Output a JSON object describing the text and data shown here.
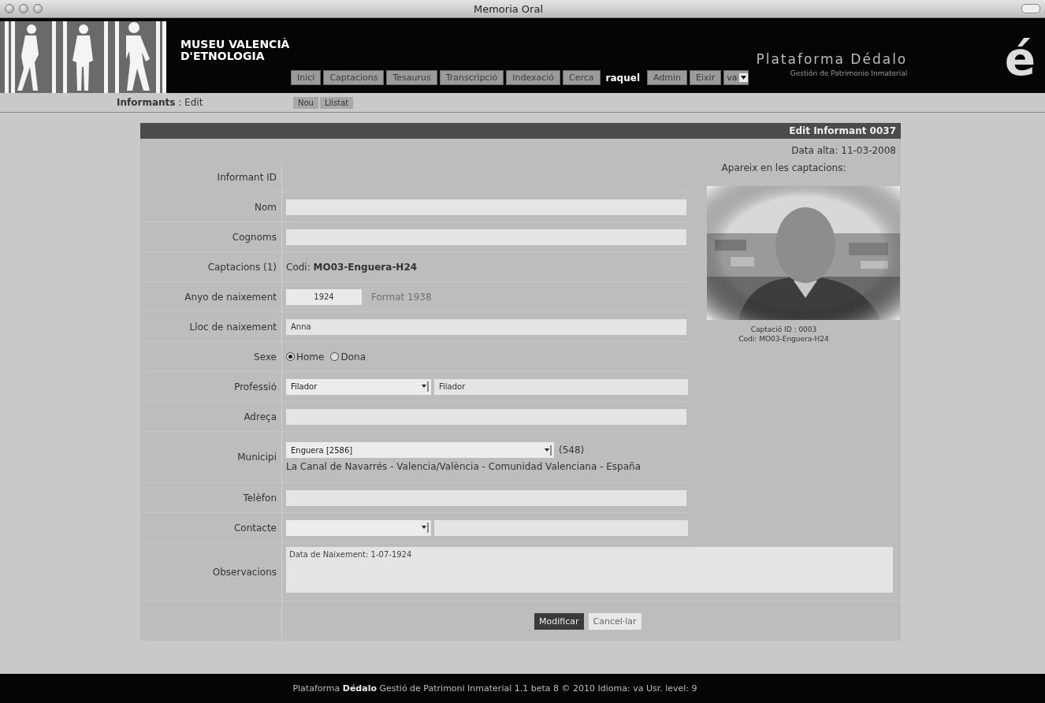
{
  "window": {
    "title": "Memoria Oral"
  },
  "header": {
    "logo_lines": [
      "MUSEU VALENCIÀ",
      "D'ETNOLOGIA"
    ],
    "nav": [
      {
        "label": "Inici",
        "selected": false
      },
      {
        "label": "Captacions",
        "selected": false
      },
      {
        "label": "Tesaurus",
        "selected": false
      },
      {
        "label": "Transcripció",
        "selected": false
      },
      {
        "label": "Indexació",
        "selected": false
      },
      {
        "label": "Cerca",
        "selected": false
      }
    ],
    "user": "raquel",
    "user_nav": [
      {
        "label": "Admin"
      },
      {
        "label": "Eixir"
      }
    ],
    "language": "va",
    "brand": "Plataforma Dédalo",
    "brand_subtitle": "Gestión de Patrimonio Inmaterial",
    "brand_mark": "é"
  },
  "subnav": {
    "title": "**Informants** : Edit",
    "buttons": [
      "Nou",
      "Llistat"
    ]
  },
  "form": {
    "title": "Edit Informant 0037",
    "date": "Data alta: 11-03-2008",
    "fields": [
      {
        "kind": "static",
        "label": "Informant ID"
      },
      {
        "kind": "text",
        "label": "Nom"
      },
      {
        "kind": "text",
        "label": "Cognoms"
      },
      {
        "kind": "info",
        "label": "Captacions (1)",
        "text": "Codi: **MO03-Enguera-H24**"
      },
      {
        "kind": "year",
        "label": "Anyo de naixement",
        "value": "1924",
        "hint": "Format 1938"
      },
      {
        "kind": "text",
        "label": "Lloc de naixement",
        "value": "Anna"
      },
      {
        "kind": "radio",
        "label": "Sexe",
        "options": [
          {
            "label": "Home",
            "selected": true
          },
          {
            "label": "Dona",
            "selected": false
          }
        ]
      },
      {
        "kind": "select_text",
        "label": "Professió",
        "select": "Filador",
        "value": "Filador"
      },
      {
        "kind": "text",
        "label": "Adreça"
      },
      {
        "kind": "municipi",
        "label": "Municipi",
        "select": "Enguera [2586]",
        "count": "(548)",
        "location": "La Canal de Navarrés - Valencia/València - Comunidad Valenciana - España"
      },
      {
        "kind": "text",
        "label": "Telèfon"
      },
      {
        "kind": "select_text",
        "label": "Contacte"
      }
    ],
    "observations": {
      "label": "Observacions",
      "value": "Data de Naixement: 1-07-1924"
    },
    "side": {
      "caption": "Apareix en les captacions:",
      "photo_lines": [
        "Captació ID : 0003",
        "Codi: MO03-Enguera-H24"
      ]
    },
    "buttons": [
      {
        "label": "Modificar",
        "kind": "primary"
      },
      {
        "label": "Cancel·lar",
        "kind": "secondary"
      }
    ]
  },
  "footer": "Plataforma **Dédalo** Gestió de Patrimoni Inmaterial 1.1 beta 8 © 2010 Idioma: va Usr. level: 9"
}
